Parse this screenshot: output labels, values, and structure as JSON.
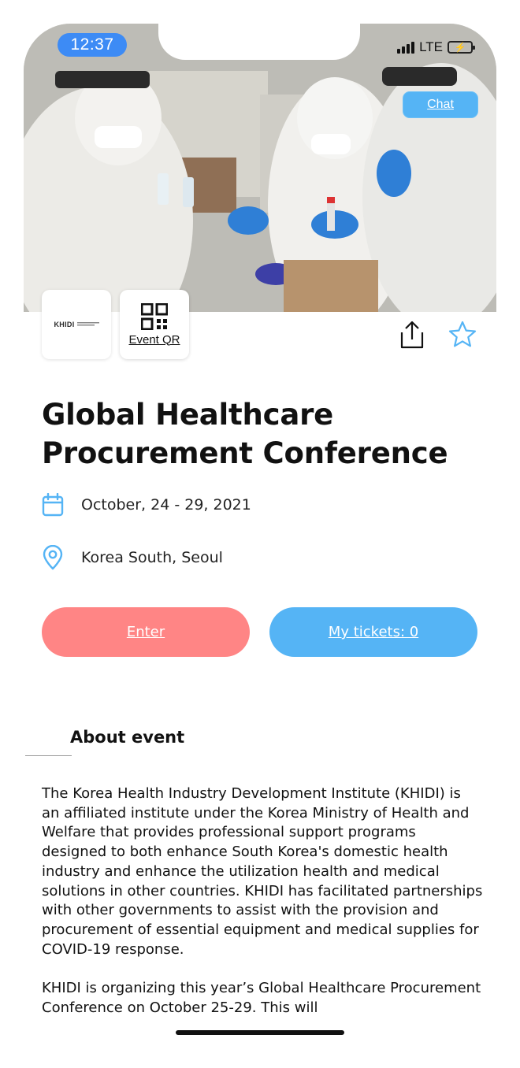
{
  "status_bar": {
    "time": "12:37",
    "network": "LTE"
  },
  "hero": {
    "chat_label": "Chat",
    "image_description_icon": "medical-workers-photo"
  },
  "organizer": {
    "logo_text": "KHIDI",
    "qr_label": "Event QR"
  },
  "actions": {
    "share_icon": "share-icon",
    "favorite_icon": "star-icon"
  },
  "event": {
    "title": "Global Healthcare Procurement Conference",
    "date": "October, 24 - 29, 2021",
    "location": "Korea South, Seoul"
  },
  "buttons": {
    "enter_label": "Enter",
    "tickets_label": "My tickets: 0"
  },
  "about": {
    "heading": "About event",
    "paragraphs": [
      "The Korea Health Industry Development Institute (KHIDI) is an affiliated institute under the Korea Ministry of Health and Welfare that provides professional support programs designed to both enhance South Korea's domestic health industry and enhance the utilization health and medical solutions in other countries. KHIDI has facilitated partnerships with other governments to assist with the provision and procurement of essential equipment and medical supplies for COVID-19 response.",
      "KHIDI is organizing this year’s Global Healthcare Procurement Conference on October 25-29. This will"
    ]
  },
  "colors": {
    "accent_blue": "#55b4f5",
    "enter_red": "#ff8585",
    "time_pill": "#3d8bf5"
  }
}
